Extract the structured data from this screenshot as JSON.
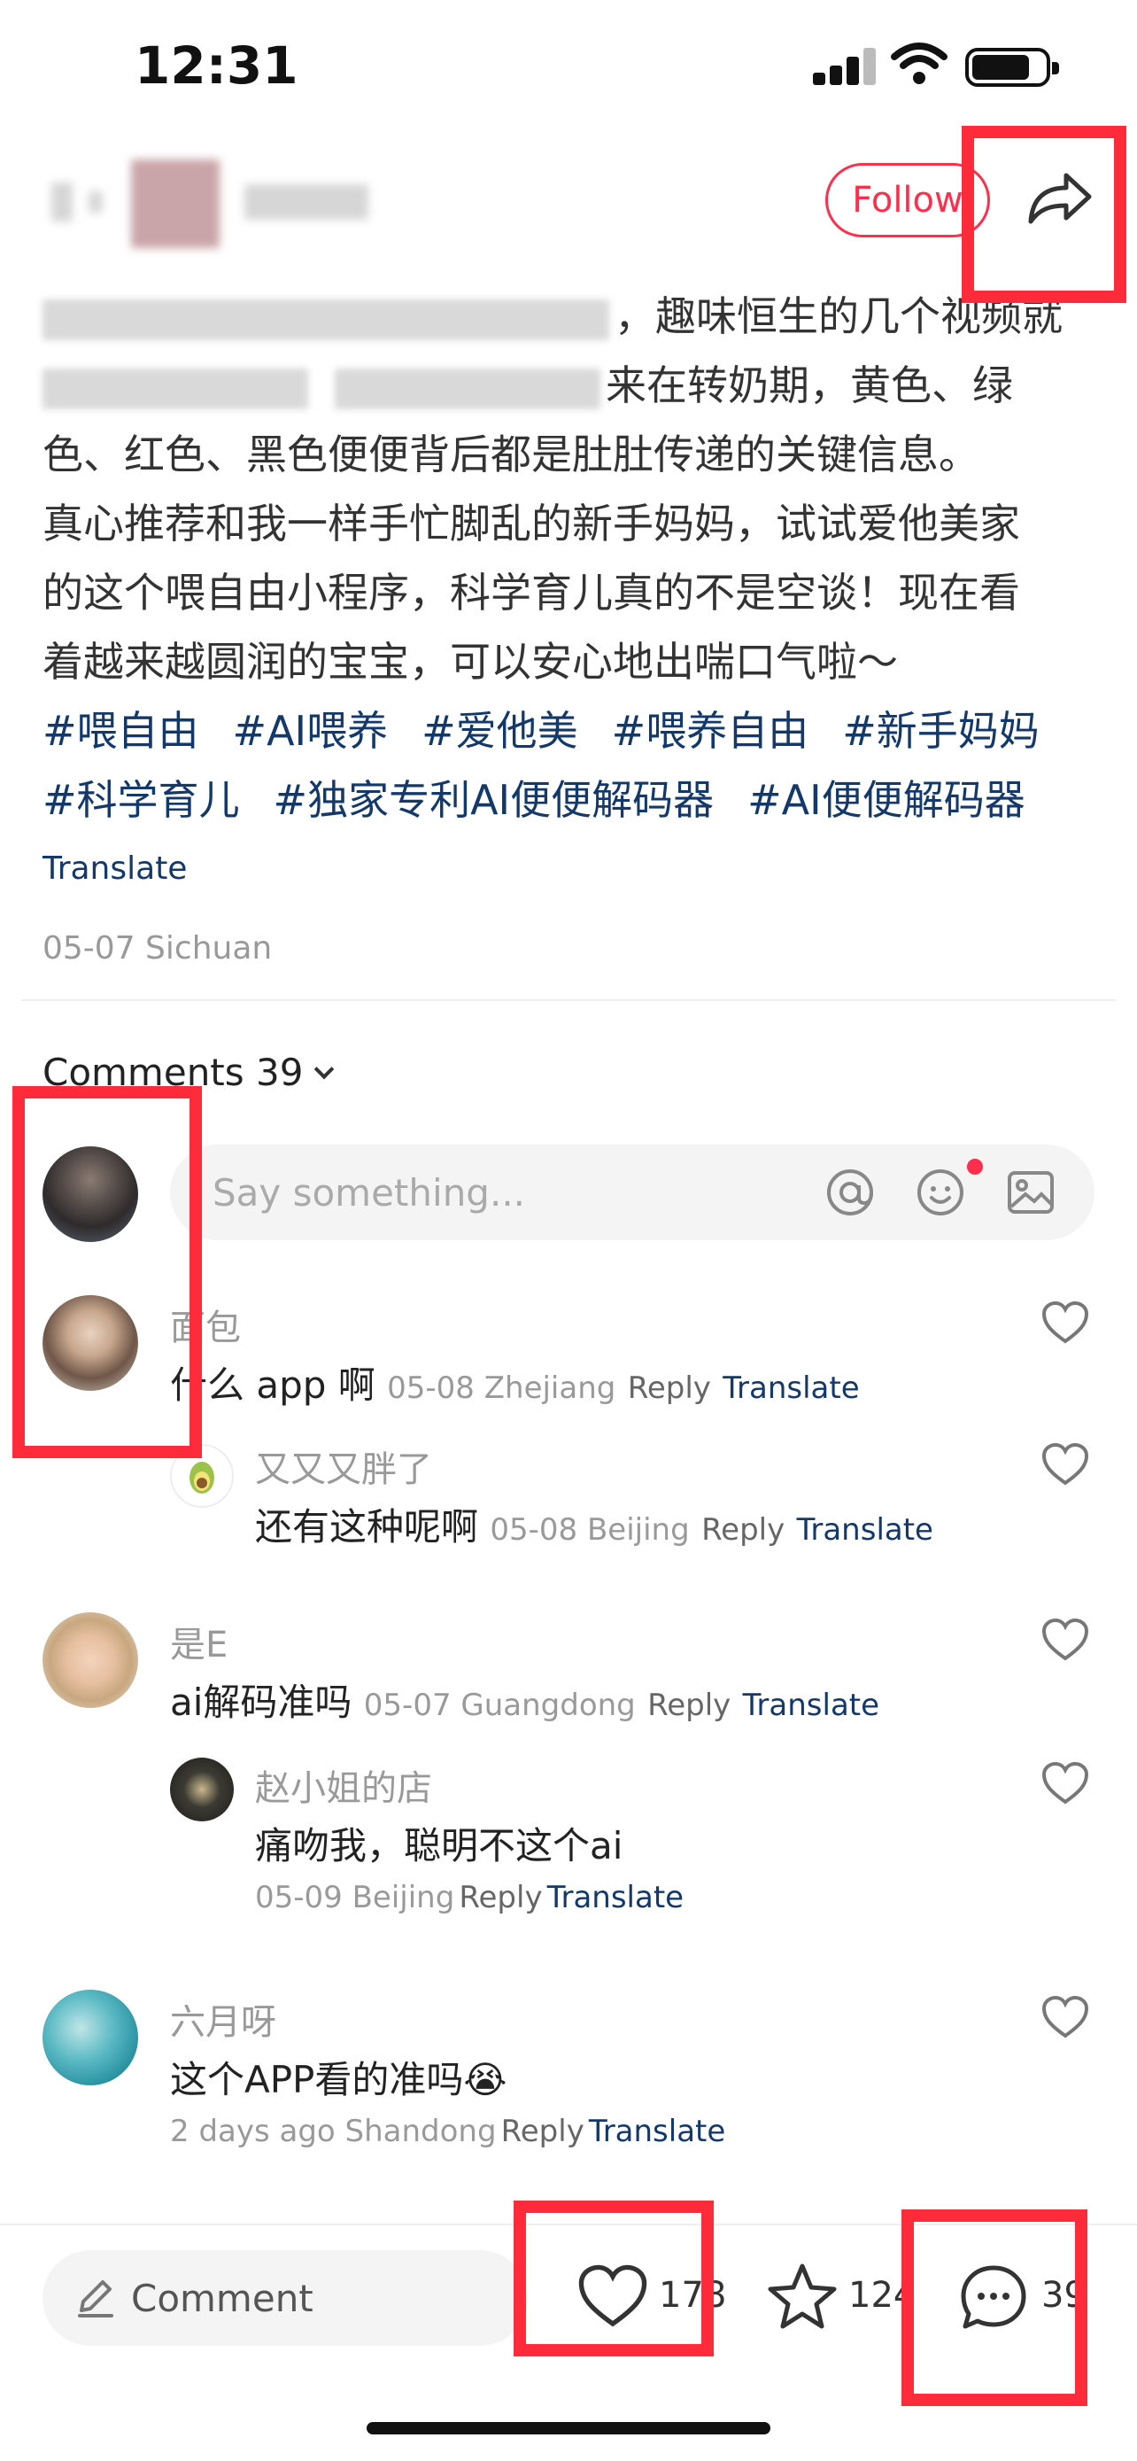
{
  "status_bar": {
    "time": "12:31"
  },
  "header": {
    "follow_label": "Follow"
  },
  "post": {
    "line1_visible": "，趣味恒生的几个视频就",
    "line2_visible": "来在转奶期，黄色、绿",
    "line3": "色、红色、黑色便便背后都是肚肚传递的关键信息。",
    "line4": "真心推荐和我一样手忙脚乱的新手妈妈，试试爱他美家",
    "line5": "的这个喂自由小程序，科学育儿真的不是空谈！现在看",
    "line6": "着越来越圆润的宝宝，可以安心地出喘口气啦～",
    "tags_row1": [
      "#喂自由",
      "#AI喂养",
      "#爱他美",
      "#喂养自由",
      "#新手妈妈"
    ],
    "tags_row2": [
      "#科学育儿",
      "#独家专利AI便便解码器",
      "#AI便便解码器"
    ],
    "translate_label": "Translate",
    "date_location": "05-07 Sichuan"
  },
  "comments_section": {
    "header": "Comments 39",
    "input_placeholder": "Say something..."
  },
  "comments": [
    {
      "name": "面包",
      "text": "什么 app 啊",
      "meta": "05-08 Zhejiang",
      "reply": "Reply",
      "translate": "Translate",
      "reply_item": {
        "name": "又又又胖了",
        "text": "还有这种呢啊",
        "meta": "05-08 Beijing",
        "reply": "Reply",
        "translate": "Translate"
      }
    },
    {
      "name": "是E",
      "text": "ai解码准吗",
      "meta": "05-07 Guangdong",
      "reply": "Reply",
      "translate": "Translate",
      "reply_item": {
        "name": "赵小姐的店",
        "text": "痛吻我，聪明不这个ai",
        "meta": "05-09 Beijing",
        "reply": "Reply",
        "translate": "Translate"
      }
    },
    {
      "name": "六月呀",
      "text": "这个APP看的准吗😭",
      "meta": "2 days ago Shandong",
      "reply": "Reply",
      "translate": "Translate"
    }
  ],
  "bottom_bar": {
    "comment_label": "Comment",
    "like_count": "178",
    "star_count": "124",
    "comment_count": "39"
  },
  "colors": {
    "accent": "#ff2e4d",
    "link": "#13386c",
    "annotation": "#ff2b3a"
  }
}
